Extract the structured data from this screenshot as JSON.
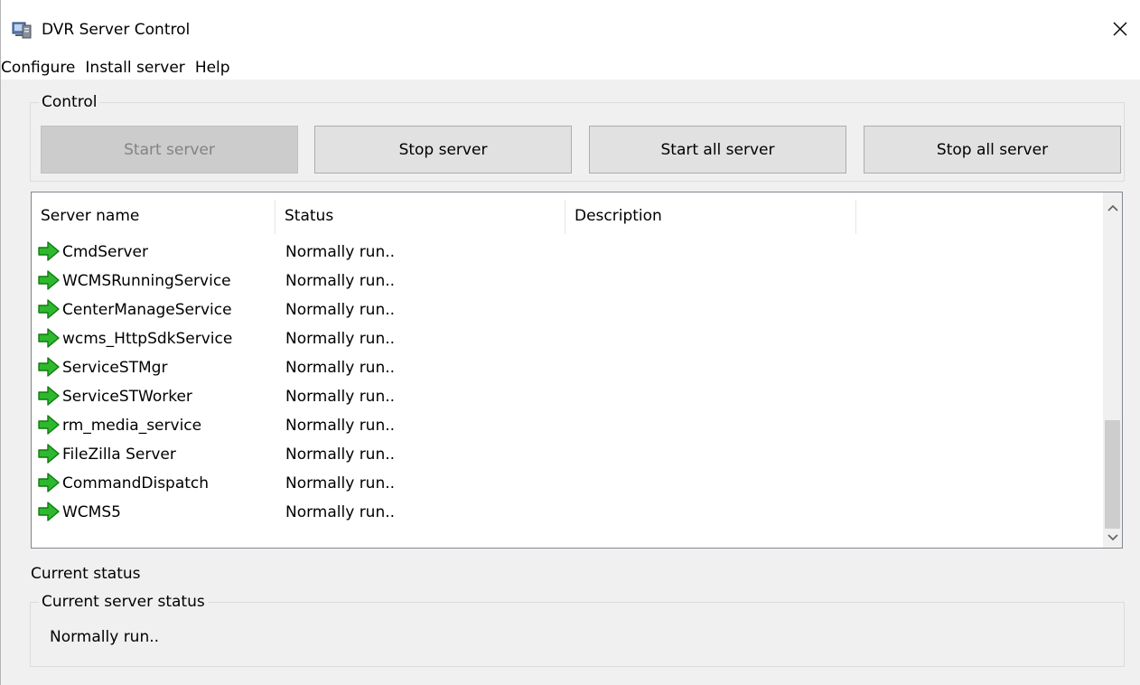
{
  "window": {
    "title": "DVR Server Control",
    "close_glyph": "✕"
  },
  "menu": [
    "Configure",
    "Install server",
    "Help"
  ],
  "control": {
    "group_label": "Control",
    "buttons": {
      "start_server": "Start server",
      "stop_server": "Stop server",
      "start_all": "Start all server",
      "stop_all": "Stop all server"
    }
  },
  "list": {
    "columns": [
      "Server name",
      "Status",
      "Description"
    ],
    "rows": [
      {
        "name": "CmdServer",
        "status": "Normally run..",
        "icon": "green-arrow-icon"
      },
      {
        "name": "WCMSRunningService",
        "status": "Normally run..",
        "icon": "green-arrow-icon"
      },
      {
        "name": "CenterManageService",
        "status": "Normally run..",
        "icon": "green-arrow-icon"
      },
      {
        "name": "wcms_HttpSdkService",
        "status": "Normally run..",
        "icon": "green-arrow-icon"
      },
      {
        "name": "ServiceSTMgr",
        "status": "Normally run..",
        "icon": "green-arrow-icon"
      },
      {
        "name": "ServiceSTWorker",
        "status": "Normally run..",
        "icon": "green-arrow-icon"
      },
      {
        "name": "rm_media_service",
        "status": "Normally run..",
        "icon": "green-arrow-icon"
      },
      {
        "name": "FileZilla Server",
        "status": "Normally run..",
        "icon": "green-arrow-icon"
      },
      {
        "name": "CommandDispatch",
        "status": "Normally run..",
        "icon": "green-arrow-icon"
      },
      {
        "name": "WCMS5",
        "status": "Normally run..",
        "icon": "green-arrow-icon"
      }
    ]
  },
  "current_status": {
    "label": "Current status",
    "group_label": "Current server status",
    "value": "Normally run.."
  },
  "colors": {
    "arrow_green": "#2eb82e",
    "arrow_dark": "#0f7a0f",
    "disabled_button": "#cccccc",
    "button": "#e1e1e1"
  }
}
